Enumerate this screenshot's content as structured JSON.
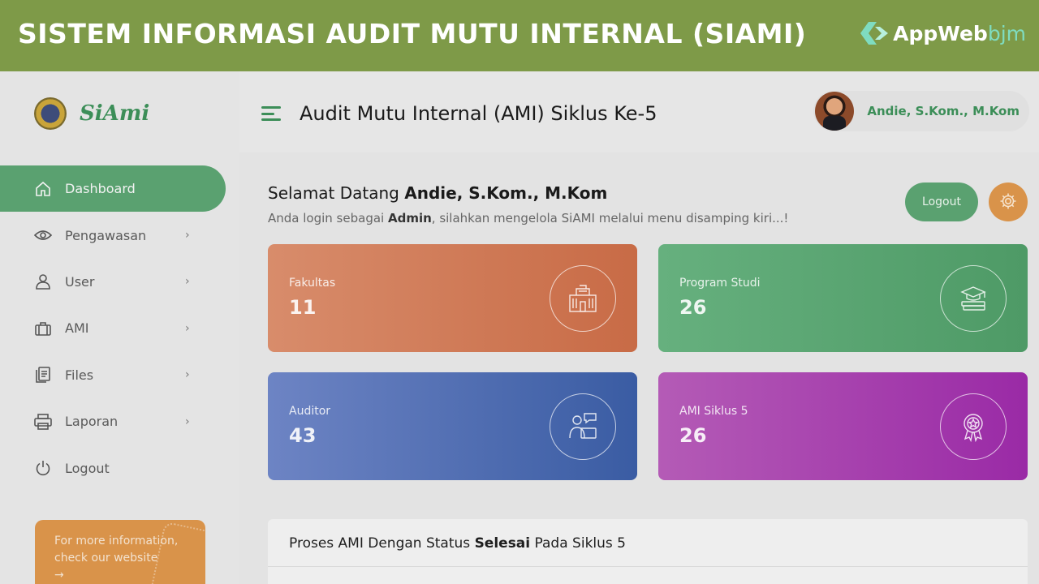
{
  "banner": {
    "title": "SISTEM INFORMASI AUDIT MUTU INTERNAL (SIAMI)",
    "brand_main": "AppWeb",
    "brand_sub": "bjm"
  },
  "app": {
    "logo_text": "SiAmi"
  },
  "sidebar": {
    "items": [
      {
        "label": "Dashboard",
        "icon": "home-icon",
        "active": true
      },
      {
        "label": "Pengawasan",
        "icon": "eye-icon"
      },
      {
        "label": "User",
        "icon": "user-icon"
      },
      {
        "label": "AMI",
        "icon": "briefcase-icon"
      },
      {
        "label": "Files",
        "icon": "file-icon"
      },
      {
        "label": "Laporan",
        "icon": "printer-icon"
      },
      {
        "label": "Logout",
        "icon": "power-icon"
      }
    ],
    "promo": {
      "line1": "For more information,",
      "line2": "check our website",
      "arrow": "→"
    }
  },
  "header": {
    "title": "Audit Mutu Internal (AMI) Siklus Ke-5",
    "user_name": "Andie, S.Kom., M.Kom"
  },
  "main": {
    "welcome_prefix": "Selamat Datang",
    "welcome_name": "Andie, S.Kom., M.Kom",
    "sub_prefix": "Anda login sebagai",
    "sub_role": "Admin",
    "sub_suffix": ", silahkan mengelola SiAMI melalui menu disamping kiri...!",
    "logout_label": "Logout",
    "cards": [
      {
        "label": "Fakultas",
        "value": "11",
        "icon": "building-icon"
      },
      {
        "label": "Program Studi",
        "value": "26",
        "icon": "graduation-books-icon"
      },
      {
        "label": "Auditor",
        "value": "43",
        "icon": "auditor-icon"
      },
      {
        "label": "AMI Siklus 5",
        "value": "26",
        "icon": "award-icon"
      }
    ],
    "panel": {
      "prefix": "Proses AMI Dengan Status",
      "status": "Selesai",
      "suffix": "Pada Siklus 5"
    }
  },
  "colors": {
    "banner": "#7e9a48",
    "accent_green": "#5aa170",
    "accent_orange": "#d9934a",
    "card_fakultas": "#d07a57",
    "card_prodi": "#5aa570",
    "card_auditor": "#5570b4",
    "card_ami": "#a640ae"
  }
}
